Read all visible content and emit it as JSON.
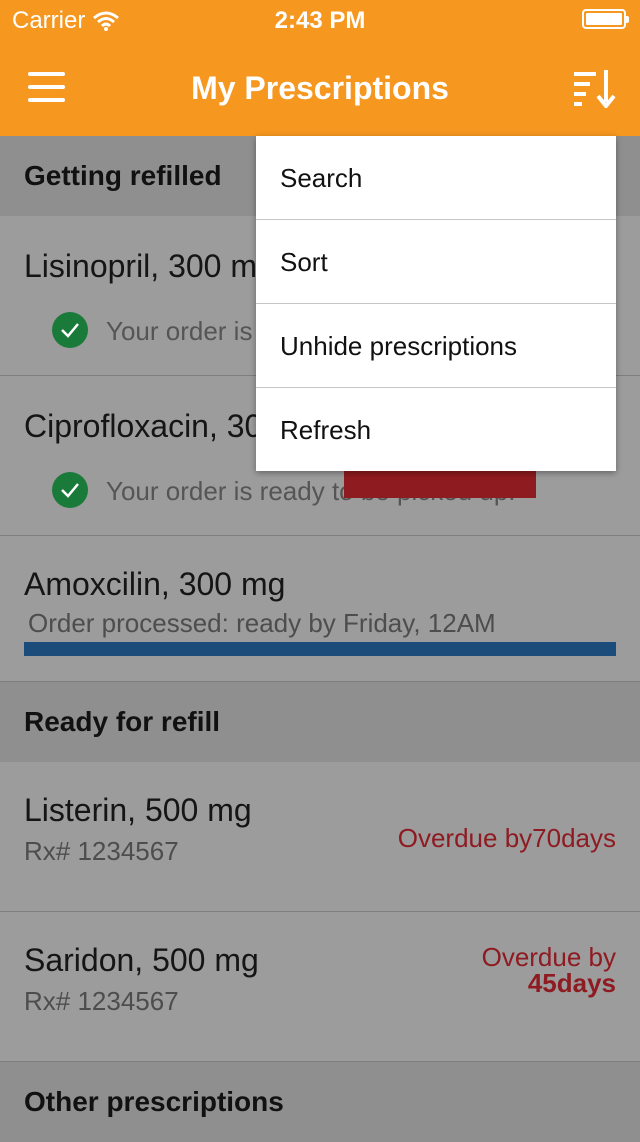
{
  "status_bar": {
    "carrier": "Carrier",
    "time": "2:43 PM",
    "wifi_icon": "wifi-icon",
    "battery_icon": "battery-icon"
  },
  "nav": {
    "title": "My Prescriptions",
    "menu_icon": "hamburger-menu-icon",
    "sort_icon": "sort-icon",
    "bar_color": "#f6971f"
  },
  "sections": {
    "getting_refilled": "Getting refilled",
    "ready_for_refill": "Ready for refill",
    "other": "Other prescriptions"
  },
  "prescriptions": [
    {
      "name": "Lisinopril, 300 mg",
      "status": "Your order is ready to be picked up."
    },
    {
      "name": "Ciprofloxacin, 300 mg",
      "status": "Your order is ready to be picked up."
    },
    {
      "name": "Amoxcilin, 300 mg",
      "status": "Order processed: ready by Friday, 12AM",
      "progress_percent": 100
    },
    {
      "name": "Listerin, 500 mg",
      "rx": "Rx# 1234567",
      "overdue": "Overdue by70days"
    },
    {
      "name": "Saridon, 500 mg",
      "rx": "Rx# 1234567",
      "overdue_label": "Overdue by",
      "overdue_value": "45days"
    }
  ],
  "menu": {
    "items": [
      "Search",
      "Sort",
      "Unhide prescriptions",
      "Refresh"
    ]
  },
  "colors": {
    "accent": "#f6971f",
    "overdue": "#8e1b22",
    "progress": "#1b4c7a",
    "check": "#1a7a3a"
  }
}
